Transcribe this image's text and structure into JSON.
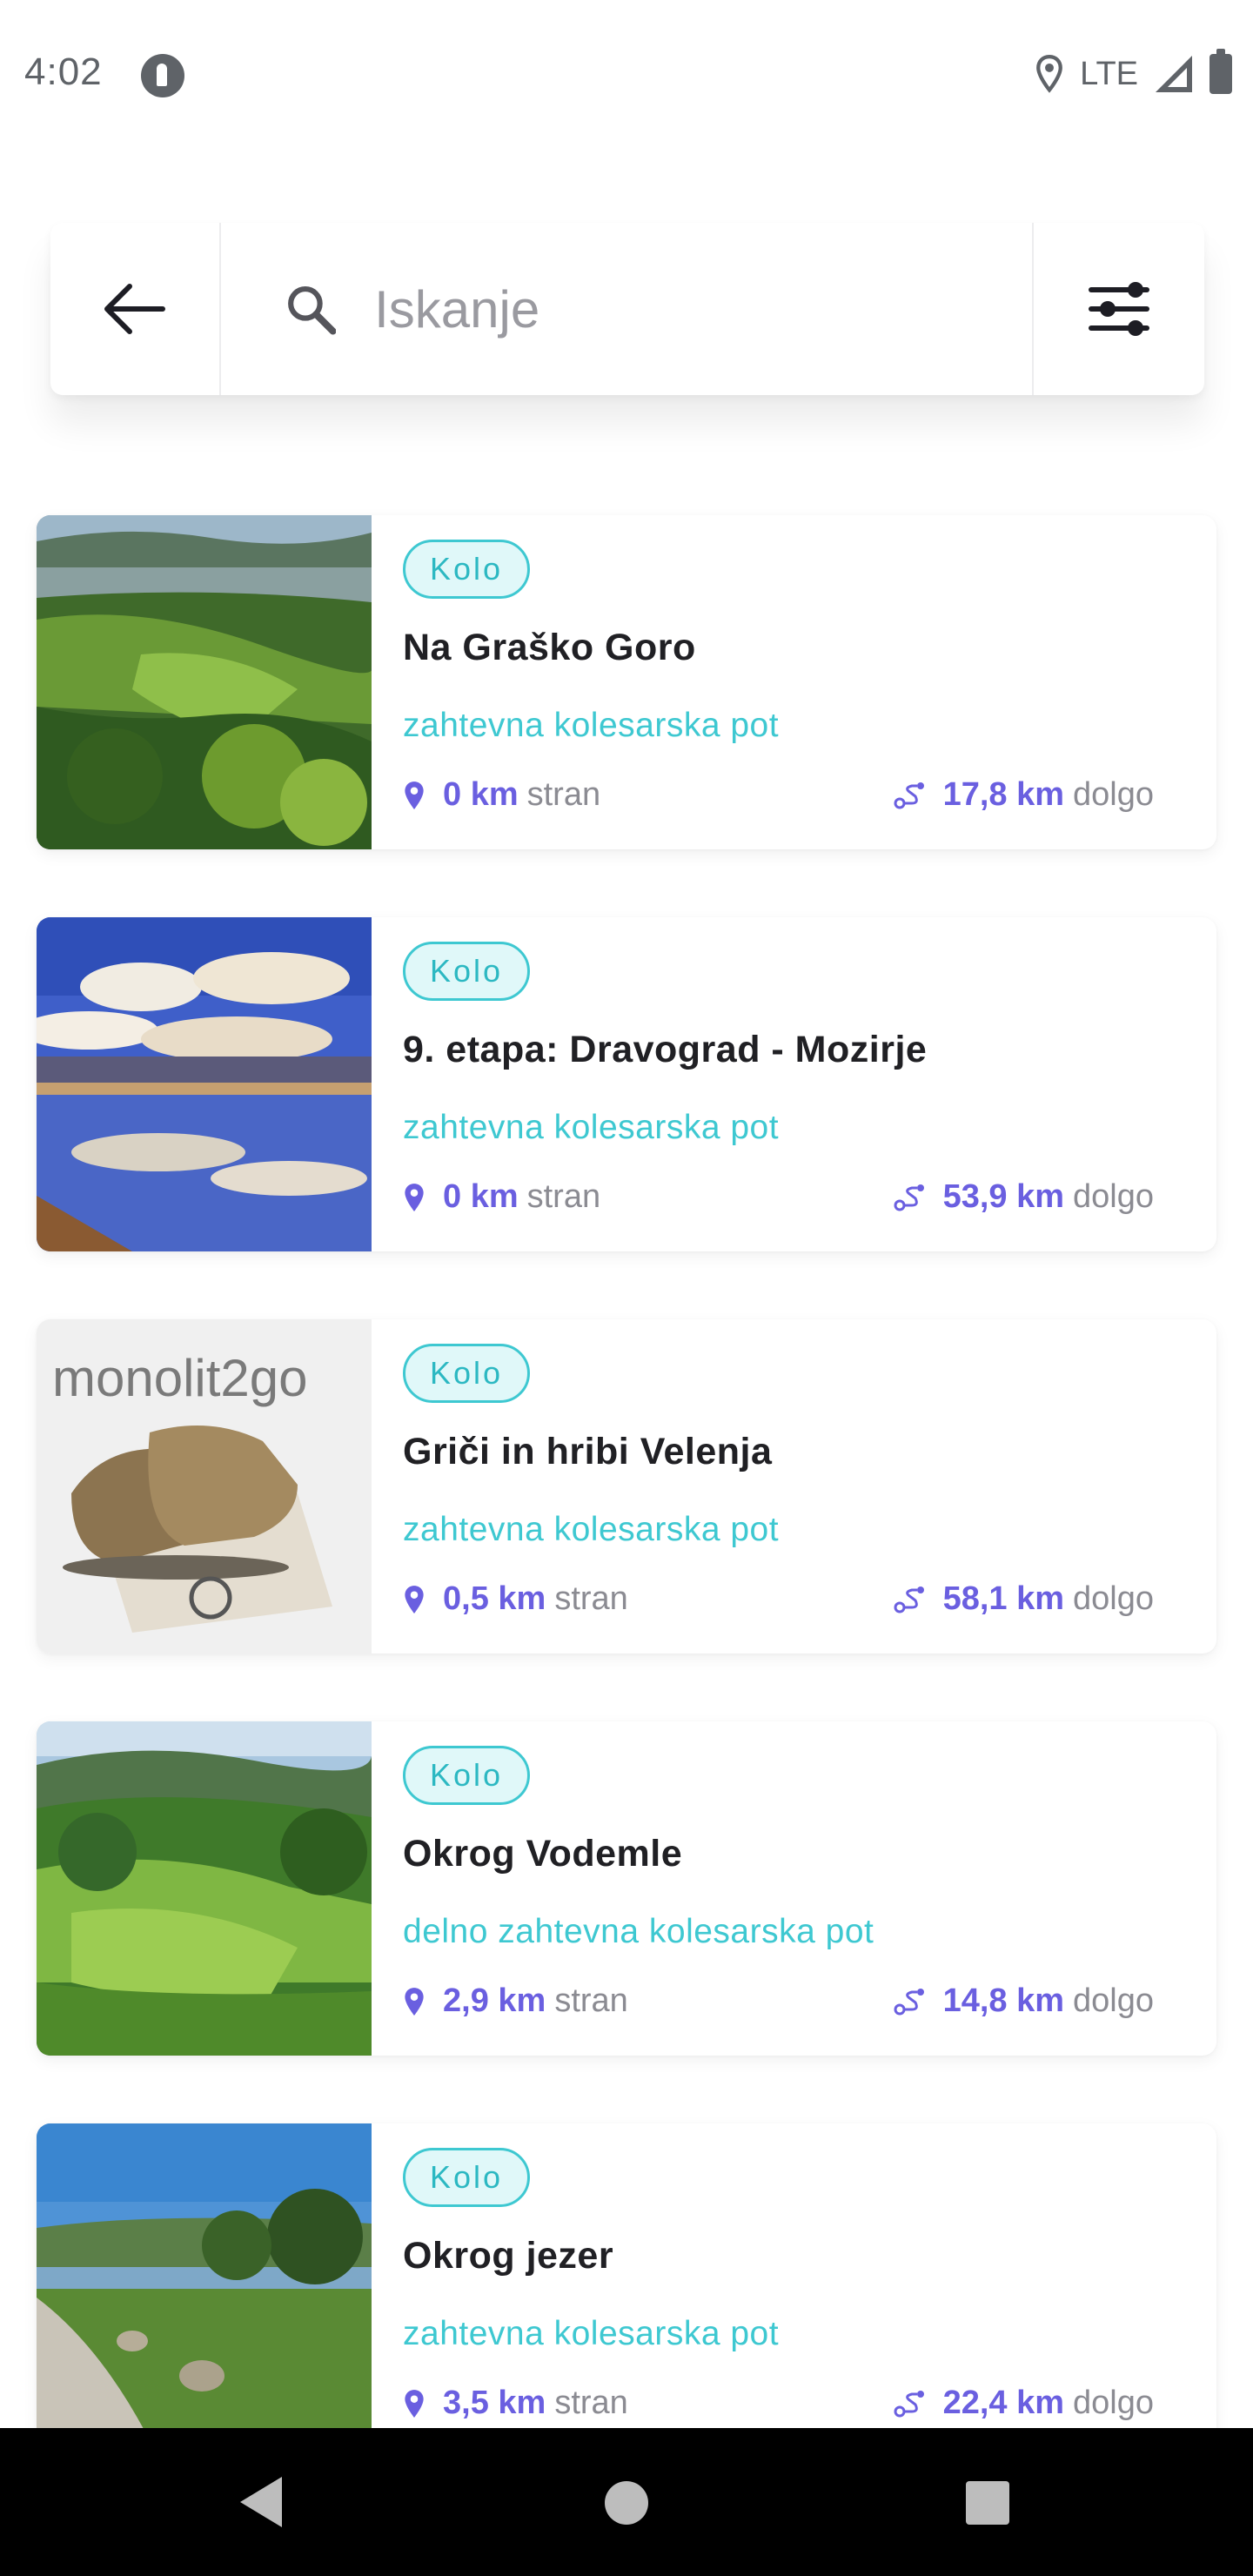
{
  "status_bar": {
    "time": "4:02",
    "network": "LTE",
    "icons": [
      "app-notification-icon",
      "location-icon",
      "signal-icon",
      "battery-icon"
    ]
  },
  "search": {
    "placeholder": "Iskanje",
    "back_icon": "arrow-left-icon",
    "search_icon": "search-icon",
    "filter_icon": "filter-sliders-icon"
  },
  "colors": {
    "accent_teal": "#3ec8d1",
    "accent_purple": "#6a5fe0",
    "muted_text": "#8b8b92"
  },
  "routes": [
    {
      "tag": "Kolo",
      "title": "Na Graško Goro",
      "difficulty": "zahtevna kolesarska pot",
      "distance_away": "0 km",
      "away_label": "stran",
      "length": "17,8 km",
      "length_label": "dolgo"
    },
    {
      "tag": "Kolo",
      "title": "9. etapa: Dravograd - Mozirje",
      "difficulty": "zahtevna kolesarska pot",
      "distance_away": "0 km",
      "away_label": "stran",
      "length": "53,9 km",
      "length_label": "dolgo"
    },
    {
      "tag": "Kolo",
      "title": "Griči in hribi Velenja",
      "difficulty": "zahtevna kolesarska pot",
      "distance_away": "0,5 km",
      "away_label": "stran",
      "length": "58,1 km",
      "length_label": "dolgo",
      "thumbnail_logo_text": "monolit2go"
    },
    {
      "tag": "Kolo",
      "title": "Okrog Vodemle",
      "difficulty": "delno zahtevna kolesarska pot",
      "distance_away": "2,9 km",
      "away_label": "stran",
      "length": "14,8 km",
      "length_label": "dolgo"
    },
    {
      "tag": "Kolo",
      "title": "Okrog jezer",
      "difficulty": "zahtevna kolesarska pot",
      "distance_away": "3,5 km",
      "away_label": "stran",
      "length": "22,4 km",
      "length_label": "dolgo"
    }
  ],
  "nav_bar": {
    "icons": [
      "nav-back-icon",
      "nav-home-icon",
      "nav-recents-icon"
    ]
  }
}
